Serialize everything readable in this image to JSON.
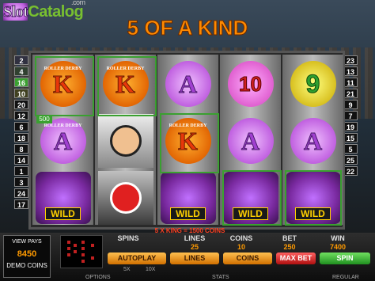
{
  "logo": {
    "part1": "Slot",
    "part2": "Catalog",
    "suffix": ".com"
  },
  "headline": "5 OF A KIND",
  "left_lines": [
    "2",
    "4",
    "16",
    "10",
    "20",
    "12",
    "6",
    "18",
    "8",
    "14",
    "1",
    "3",
    "24",
    "17"
  ],
  "right_lines": [
    "23",
    "13",
    "11",
    "21",
    "9",
    "7",
    "19",
    "15",
    "5",
    "25",
    "22"
  ],
  "win_badge": "500",
  "reels": [
    [
      "K",
      "A",
      "WILD"
    ],
    [
      "K",
      "REF",
      "GIRL"
    ],
    [
      "A",
      "K",
      "WILD"
    ],
    [
      "10",
      "A",
      "WILD"
    ],
    [
      "9",
      "A",
      "WILD"
    ]
  ],
  "roller_derby_text": "ROLLER DERBY",
  "wild_text": "WILD",
  "win_message": "5 X KING = 1500 COINS",
  "panel": {
    "view_pays": "VIEW PAYS",
    "balance": "8450",
    "demo_coins": "DEMO COINS",
    "spins_label": "SPINS",
    "lines_label": "LINES",
    "lines_value": "25",
    "coins_label": "COINS",
    "coins_value": "10",
    "bet_label": "BET",
    "bet_value": "250",
    "win_label": "WIN",
    "win_value": "7400",
    "autoplay": "AUTOPLAY",
    "lines_btn": "LINES",
    "coins_btn": "COINS",
    "max_bet": "MAX BET",
    "spin": "SPIN",
    "x5": "5X",
    "x10": "10X",
    "options": "OPTIONS",
    "stats": "STATS",
    "regular": "REGULAR"
  }
}
